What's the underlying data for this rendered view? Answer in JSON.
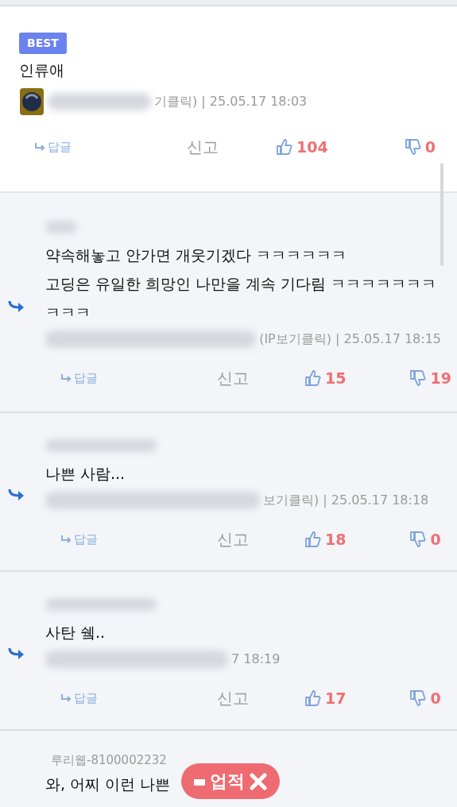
{
  "best_comment": {
    "badge": "BEST",
    "text": "인류애",
    "meta": "기클릭) | 25.05.17 18:03",
    "reply_label": "답글",
    "report_label": "신고",
    "likes": "104",
    "dislikes": "0"
  },
  "replies": [
    {
      "text": "약속해놓고 안가면 개웃기겠다 ㅋㅋㅋㅋㅋㅋ\n고딩은 유일한 희망인 나만을 계속 기다림 ㅋㅋㅋㅋㅋㅋㅋㅋㅋㅋ",
      "meta": "(IP보기클릭) | 25.05.17 18:15",
      "reply_label": "답글",
      "report_label": "신고",
      "likes": "15",
      "dislikes": "19"
    },
    {
      "text": "나쁜 사람...",
      "meta": "보기클릭) | 25.05.17 18:18",
      "reply_label": "답글",
      "report_label": "신고",
      "likes": "18",
      "dislikes": "0"
    },
    {
      "text": "사탄 쉨..",
      "meta": "7 18:19",
      "reply_label": "답글",
      "report_label": "신고",
      "likes": "17",
      "dislikes": "0"
    }
  ],
  "last_reply": {
    "author": "루리웹-8100002232",
    "text": "와, 어찌 이런 나쁜"
  },
  "floating_button": {
    "label": "업적"
  }
}
